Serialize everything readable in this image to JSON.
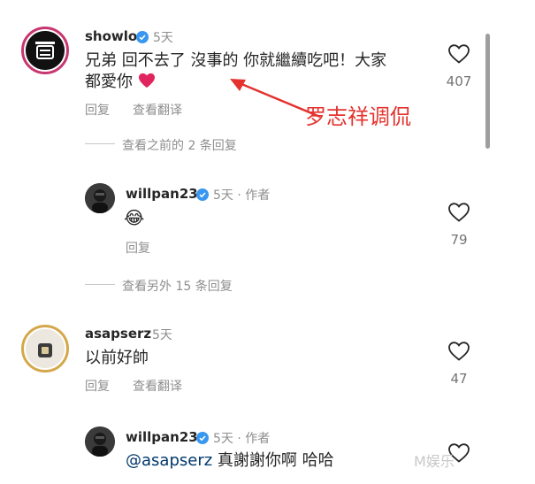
{
  "comments": [
    {
      "username": "showlo",
      "time": "5天",
      "text_line1": "兄弟 回不去了 沒事的 你就繼續吃吧！大家",
      "text_line2": "都愛你",
      "reply_label": "回复",
      "translate_label": "查看翻译",
      "likes": "407"
    },
    {
      "username": "willpan23",
      "meta": "5天 · 作者",
      "text": "😂",
      "reply_label": "回复",
      "likes": "79"
    },
    {
      "username": "asapserz",
      "time": "5天",
      "text": "以前好帥",
      "reply_label": "回复",
      "translate_label": "查看翻译",
      "likes": "47"
    },
    {
      "username": "willpan23",
      "meta": "5天 · 作者",
      "mention": "@asapserz",
      "text": " 真謝謝你啊 哈哈"
    }
  ],
  "threads": {
    "view_previous": "查看之前的 2 条回复",
    "view_more": "查看另外 15 条回复"
  },
  "annotation": {
    "text": "罗志祥调侃",
    "color": "#e4332f"
  },
  "watermark": "M娱乐",
  "colors": {
    "verified": "#3897f0",
    "ring": "#c8366f",
    "heart_emoji": "#e0245e"
  }
}
